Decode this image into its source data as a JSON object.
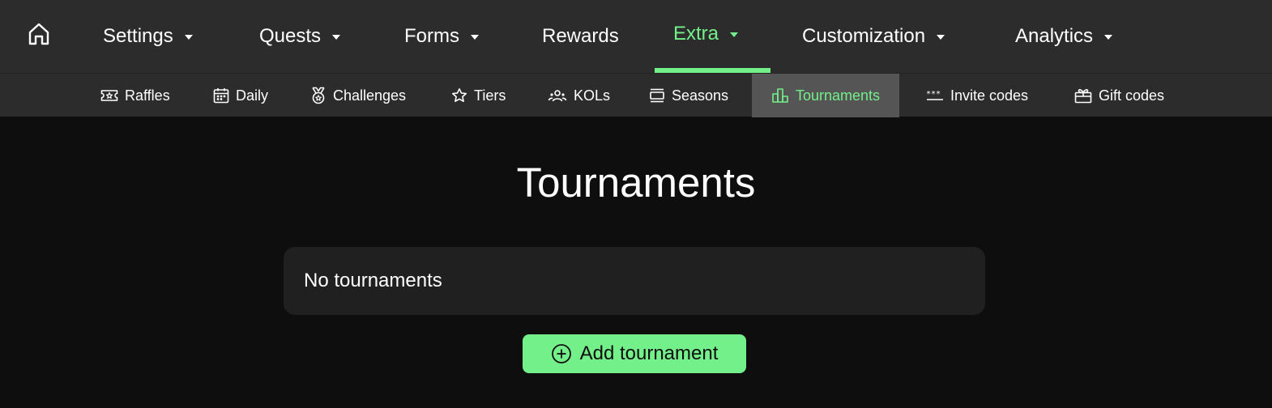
{
  "colors": {
    "accent": "#74f08a",
    "topbar": "#2c2c2c",
    "background": "#0e0e0e",
    "card": "#202020",
    "active_tab": "#555555"
  },
  "topnav": {
    "home_icon": "home-icon",
    "items": [
      {
        "label": "Settings",
        "has_caret": true
      },
      {
        "label": "Quests",
        "has_caret": true
      },
      {
        "label": "Forms",
        "has_caret": true
      },
      {
        "label": "Rewards",
        "has_caret": false
      },
      {
        "label": "Extra",
        "has_caret": true,
        "active": true
      },
      {
        "label": "Customization",
        "has_caret": true
      },
      {
        "label": "Analytics",
        "has_caret": true
      }
    ]
  },
  "subnav": {
    "items": [
      {
        "label": "Raffles",
        "icon": "ticket-icon"
      },
      {
        "label": "Daily",
        "icon": "calendar-icon"
      },
      {
        "label": "Challenges",
        "icon": "medal-icon"
      },
      {
        "label": "Tiers",
        "icon": "star-icon"
      },
      {
        "label": "KOLs",
        "icon": "users-icon"
      },
      {
        "label": "Seasons",
        "icon": "layers-icon"
      },
      {
        "label": "Tournaments",
        "icon": "podium-icon",
        "active": true
      },
      {
        "label": "Invite codes",
        "icon": "asterisks-icon"
      },
      {
        "label": "Gift codes",
        "icon": "gift-icon"
      }
    ]
  },
  "main": {
    "title": "Tournaments",
    "empty_message": "No tournaments",
    "add_button_label": "Add tournament",
    "add_button_icon": "plus-circle-icon"
  }
}
